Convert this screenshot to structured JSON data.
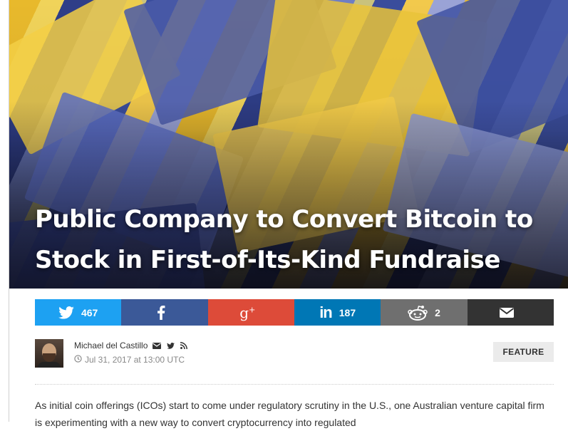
{
  "article": {
    "title": "Public Company to Convert Bitcoin to Stock in First-of-Its-Kind Fundraise",
    "author": "Michael del Castillo",
    "date": "Jul 31, 2017 at 13:00 UTC",
    "tag": "FEATURE",
    "body": "As initial coin offerings (ICOs) start to come under regulatory scrutiny in the U.S., one Australian venture capital firm is experimenting with a new way to convert cryptocurrency into regulated"
  },
  "share": {
    "twitter_count": "467",
    "facebook_count": "",
    "googleplus_count": "",
    "linkedin_count": "187",
    "reddit_count": "2",
    "email_count": ""
  },
  "icons": {
    "twitter": "twitter-icon",
    "facebook": "facebook-icon",
    "googleplus": "googleplus-icon",
    "linkedin": "linkedin-icon",
    "reddit": "reddit-icon",
    "email": "email-icon",
    "clock": "clock-icon",
    "rss": "rss-icon"
  },
  "colors": {
    "twitter": "#1da1f2",
    "facebook": "#3b5998",
    "googleplus": "#dd4b39",
    "linkedin": "#0077b5",
    "reddit": "#6f6f6f",
    "email": "#333333"
  }
}
